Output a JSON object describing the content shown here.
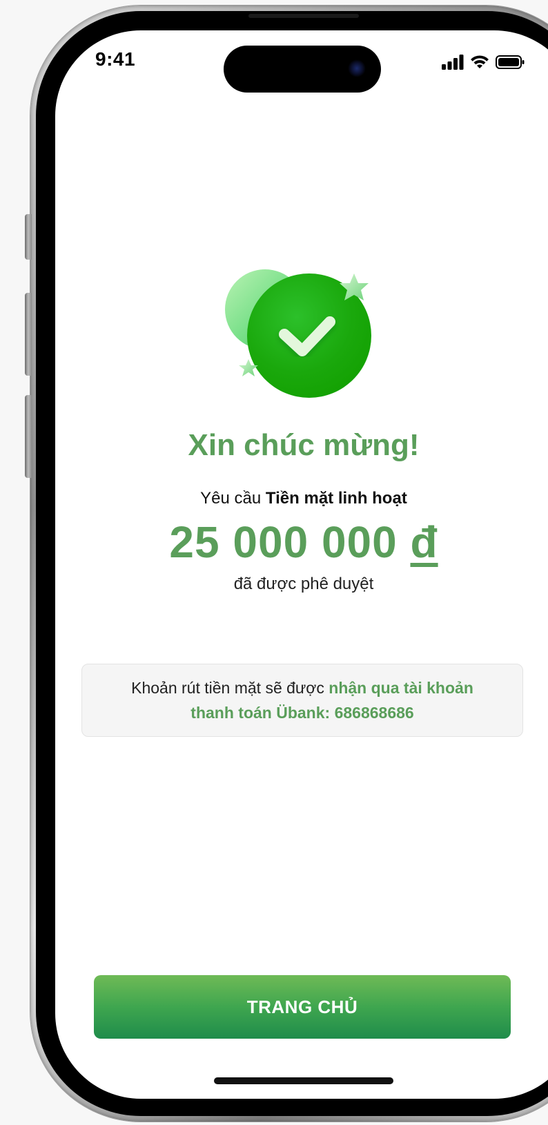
{
  "status_bar": {
    "time": "9:41",
    "icons": [
      "cellular-signal-icon",
      "wifi-icon",
      "battery-icon"
    ]
  },
  "hero": {
    "icon": "success-check-icon",
    "colors": {
      "primary_green": "#1aa40b",
      "light_green": "#7ee08c",
      "text_green": "#5a9e5a"
    }
  },
  "result": {
    "title": "Xin chúc mừng!",
    "request_prefix": "Yêu cầu ",
    "product_name": "Tiền mặt linh hoạt",
    "amount": "25 000 000",
    "currency": "đ",
    "status_text": "đã được phê duyệt"
  },
  "info": {
    "text_prefix": "Khoản rút tiền mặt sẽ được ",
    "text_highlight": "nhận qua tài khoản thanh toán Übank: 686868686"
  },
  "actions": {
    "home_label": "TRANG CHỦ"
  }
}
